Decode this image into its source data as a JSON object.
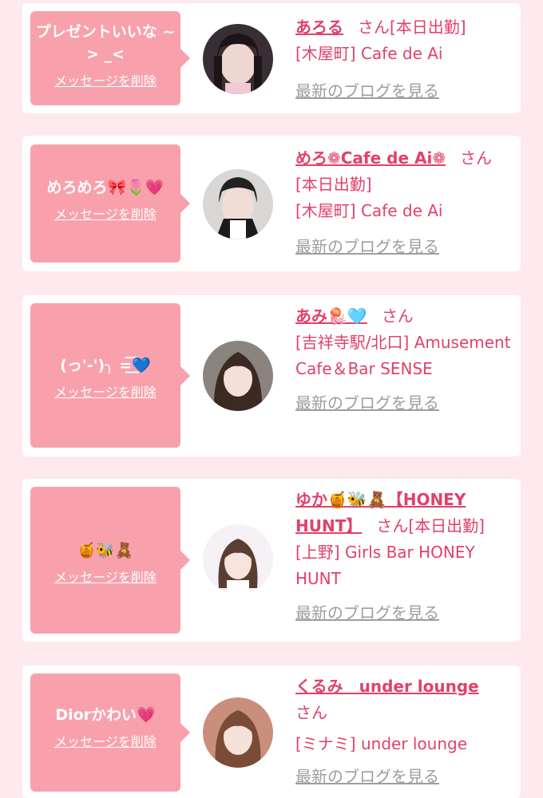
{
  "cards": [
    {
      "message": "プレゼントいいな ~> _<",
      "delete_label": "メッセージを削除",
      "cast_name": "あろる",
      "honorific": "さん",
      "status": "[本日出勤]",
      "shop": "[木屋町] Cafe de Ai",
      "blog_label": "最新のブログを見る"
    },
    {
      "message": "めろめろ🎀🌷💗",
      "delete_label": "メッセージを削除",
      "cast_name": "めろ❁Cafe de Ai❁",
      "honorific": "さん",
      "status": "[本日出勤]",
      "shop": "[木屋町] Cafe de Ai",
      "blog_label": "最新のブログを見る"
    },
    {
      "message": "(っ'-')╮ =͟͟͞͞💙",
      "delete_label": "メッセージを削除",
      "cast_name": "あみ🪼🩵",
      "honorific": "さん",
      "status": "",
      "shop": "[吉祥寺駅/北口] Amusement Cafe＆Bar SENSE",
      "blog_label": "最新のブログを見る"
    },
    {
      "message": "🍯🐝🧸",
      "delete_label": "メッセージを削除",
      "cast_name": "ゆか🍯🐝🧸【HONEY HUNT】",
      "honorific": "さん",
      "status": "[本日出勤]",
      "shop": "[上野] Girls Bar HONEY HUNT",
      "blog_label": "最新のブログを見る"
    },
    {
      "message": "Diorかわい💗",
      "delete_label": "メッセージを削除",
      "cast_name": "くるみ　under lounge",
      "honorific": "さん",
      "status": "",
      "shop": "[ミナミ] under lounge",
      "blog_label": "最新のブログを見る"
    }
  ]
}
